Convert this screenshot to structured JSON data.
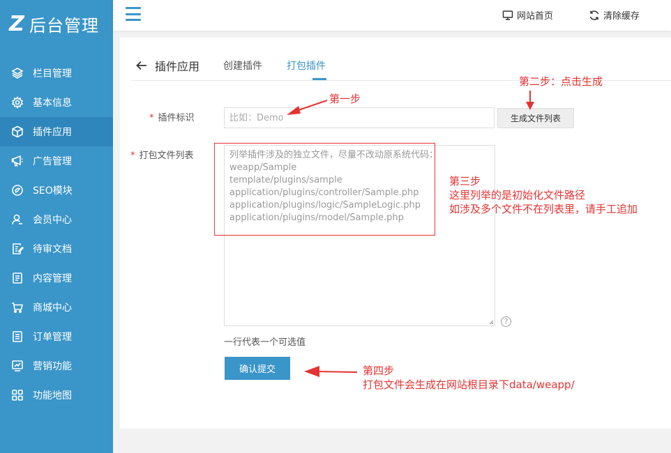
{
  "app": {
    "logo_mark": "Z",
    "logo_text": "后台管理"
  },
  "sidebar": {
    "items": [
      {
        "label": "栏目管理",
        "icon": "layers-icon"
      },
      {
        "label": "基本信息",
        "icon": "gear-icon"
      },
      {
        "label": "插件应用",
        "icon": "cube-icon",
        "active": true
      },
      {
        "label": "广告管理",
        "icon": "ad-icon"
      },
      {
        "label": "SEO模块",
        "icon": "seo-icon"
      },
      {
        "label": "会员中心",
        "icon": "user-icon"
      },
      {
        "label": "待审文档",
        "icon": "pending-doc-icon"
      },
      {
        "label": "内容管理",
        "icon": "document-icon"
      },
      {
        "label": "商城中心",
        "icon": "cart-icon"
      },
      {
        "label": "订单管理",
        "icon": "list-icon"
      },
      {
        "label": "营销功能",
        "icon": "chart-icon"
      },
      {
        "label": "功能地图",
        "icon": "grid-icon"
      }
    ]
  },
  "header": {
    "site_home": "网站首页",
    "clear_cache": "清除缓存"
  },
  "tabs": {
    "back_label": "插件应用",
    "create": "创建插件",
    "package": "打包插件"
  },
  "form": {
    "plugin_id_label": "插件标识",
    "plugin_id_placeholder": "比如：Demo",
    "generate_button": "生成文件列表",
    "file_list_label": "打包文件列表",
    "file_list_lines": [
      "列举插件涉及的独立文件，尽量不改动原系统代码：",
      "weapp/Sample",
      "template/plugins/sample",
      "application/plugins/controller/Sample.php",
      "application/plugins/logic/SampleLogic.php",
      "application/plugins/model/Sample.php"
    ],
    "help_symbol": "?",
    "hint": "一行代表一个可选值",
    "submit_button": "确认提交"
  },
  "annotations": {
    "step1": "第一步",
    "step2": "第二步：点击生成",
    "step3_line1": "第三步",
    "step3_line2": "这里列举的是初始化文件路径",
    "step3_line3": "如涉及多个文件不在列表里，请手工追加",
    "step4_line1": "第四步",
    "step4_line2": "打包文件会生成在网站根目录下data/weapp/"
  },
  "colors": {
    "accent": "#3a95c9",
    "annotation": "#e53333"
  }
}
